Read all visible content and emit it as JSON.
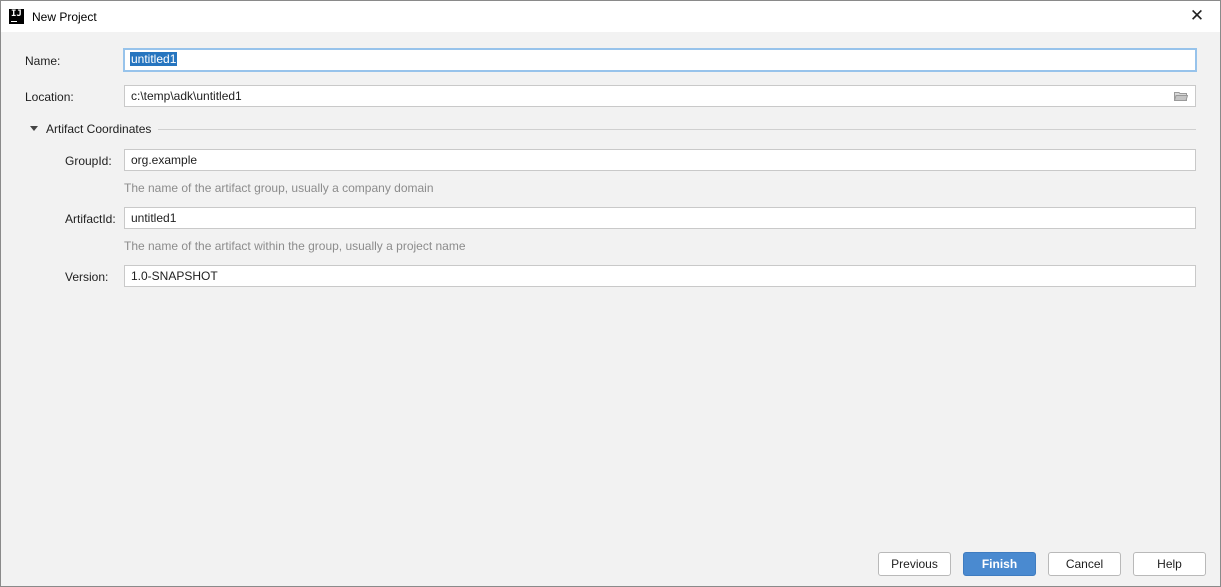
{
  "window": {
    "title": "New Project",
    "icon_name": "intellij-idea-icon",
    "app_icon_glyph": "IJ",
    "close_glyph": "✕"
  },
  "form": {
    "name": {
      "label": "Name:",
      "value": "untitled1"
    },
    "location": {
      "label": "Location:",
      "value": "c:\\temp\\adk\\untitled1",
      "icon": "folder-icon"
    },
    "artifact_section": {
      "title": "Artifact Coordinates",
      "expanded": true,
      "group_id": {
        "label": "GroupId:",
        "value": "org.example",
        "hint": "The name of the artifact group, usually a company domain"
      },
      "artifact_id": {
        "label": "ArtifactId:",
        "value": "untitled1",
        "hint": "The name of the artifact within the group, usually a project name"
      },
      "version": {
        "label": "Version:",
        "value": "1.0-SNAPSHOT"
      }
    }
  },
  "buttons": {
    "previous": "Previous",
    "finish": "Finish",
    "cancel": "Cancel",
    "help": "Help"
  },
  "colors": {
    "background": "#f2f2f2",
    "focus_border": "#97c3eb",
    "selection": "#2675bf",
    "default_button": "#4a8ad0",
    "hint_text": "#8c8c8c"
  }
}
